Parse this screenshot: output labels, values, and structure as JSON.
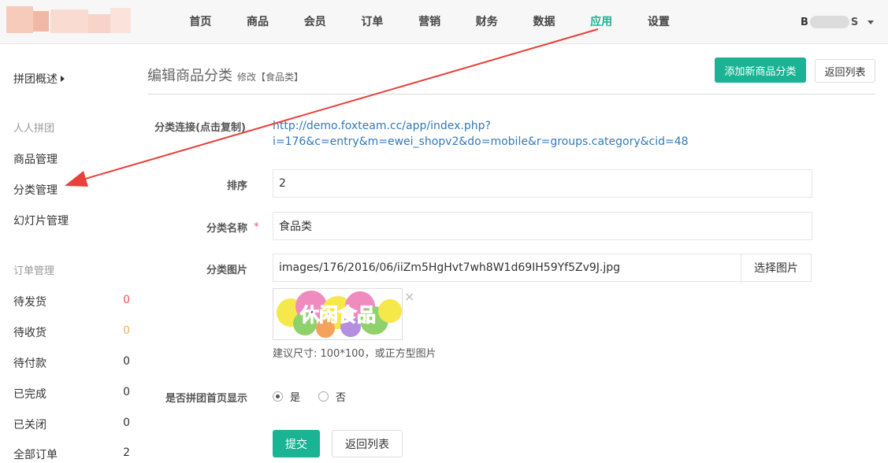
{
  "nav": {
    "items": [
      "首页",
      "商品",
      "会员",
      "订单",
      "营销",
      "财务",
      "数据",
      "应用",
      "设置"
    ],
    "active_index": 7,
    "user_initial": "B",
    "user_tail": "S"
  },
  "sidebar": {
    "overview": "拼团概述",
    "group_head": "人人拼团",
    "group_links": [
      "商品管理",
      "分类管理",
      "幻灯片管理"
    ],
    "order_head": "订单管理",
    "orders": [
      {
        "label": "待发货",
        "count": "0"
      },
      {
        "label": "待收货",
        "count": "0"
      },
      {
        "label": "待付款",
        "count": "0"
      },
      {
        "label": "已完成",
        "count": "0"
      },
      {
        "label": "已关闭",
        "count": "0"
      },
      {
        "label": "全部订单",
        "count": "2"
      }
    ]
  },
  "header": {
    "title": "编辑商品分类",
    "subtitle": "修改【食品类】",
    "add_button": "添加新商品分类",
    "back_button": "返回列表"
  },
  "form": {
    "link_label": "分类连接(点击复制)",
    "link_line1": "http://demo.foxteam.cc/app/index.php?",
    "link_line2": "i=176&c=entry&m=ewei_shopv2&do=mobile&r=groups.category&cid=48",
    "sort_label": "排序",
    "sort_value": "2",
    "name_label": "分类名称",
    "required_mark": "*",
    "name_value": "食品类",
    "image_label": "分类图片",
    "image_value": "images/176/2016/06/iiZm5HgHvt7wh8W1d69IH59Yf5Zv9J.jpg",
    "choose_image": "选择图片",
    "thumb_text": "休闲食品",
    "close_glyph": "×",
    "help_text": "建议尺寸: 100*100，或正方型图片",
    "show_label": "是否拼团首页显示",
    "radio_yes": "是",
    "radio_no": "否",
    "submit": "提交",
    "back": "返回列表"
  },
  "colors": {
    "accent": "#1ab394",
    "link": "#337ab7",
    "danger": "#ed5565",
    "warning": "#f8ac59",
    "annotation_arrow": "#e8403a"
  }
}
